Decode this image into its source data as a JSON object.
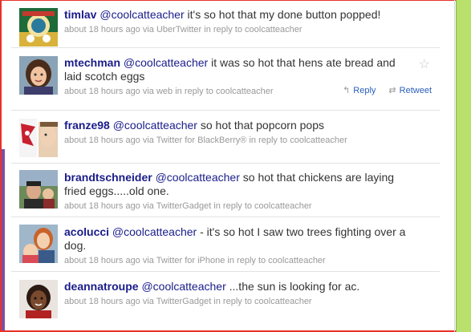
{
  "tweets": [
    {
      "username": "timlav",
      "mention": "@coolcatteacher",
      "text": " it's so hot that my done button popped!",
      "meta": "about 18 hours ago via UberTwitter in reply to coolcatteacher"
    },
    {
      "username": "mtechman",
      "mention": "@coolcatteacher",
      "text": " it was so hot that hens ate bread and laid scotch eggs",
      "meta": "about 18 hours ago via web in reply to coolcatteacher",
      "reply_label": "Reply",
      "retweet_label": "Retweet",
      "star_icon": "star-icon"
    },
    {
      "username": "franze98",
      "mention": "@coolcatteacher",
      "text": " so hot that popcorn pops",
      "meta": "about 18 hours ago via Twitter for BlackBerry® in reply to coolcatteacher"
    },
    {
      "username": "brandtschneider",
      "mention": "@coolcatteacher",
      "text": " so hot that chickens are laying fried eggs.....old one.",
      "meta": "about 18 hours ago via TwitterGadget in reply to coolcatteacher"
    },
    {
      "username": "acolucci",
      "mention": "@coolcatteacher",
      "text": " - it's so hot I saw two trees fighting over a dog.",
      "meta": "about 18 hours ago via Twitter for iPhone in reply to coolcatteacher"
    },
    {
      "username": "deannatroupe",
      "mention": "@coolcatteacher",
      "text": " ...the sun is looking for ac.",
      "meta": "about 18 hours ago via TwitterGadget in reply to coolcatteacher"
    }
  ],
  "colors": {
    "link": "#1a1c8a",
    "action_link": "#2a5fb8",
    "meta_text": "#999999",
    "frame_red": "#e8322a",
    "sidebar_green": "#b8e06a",
    "left_purple": "#7a4fa6"
  }
}
